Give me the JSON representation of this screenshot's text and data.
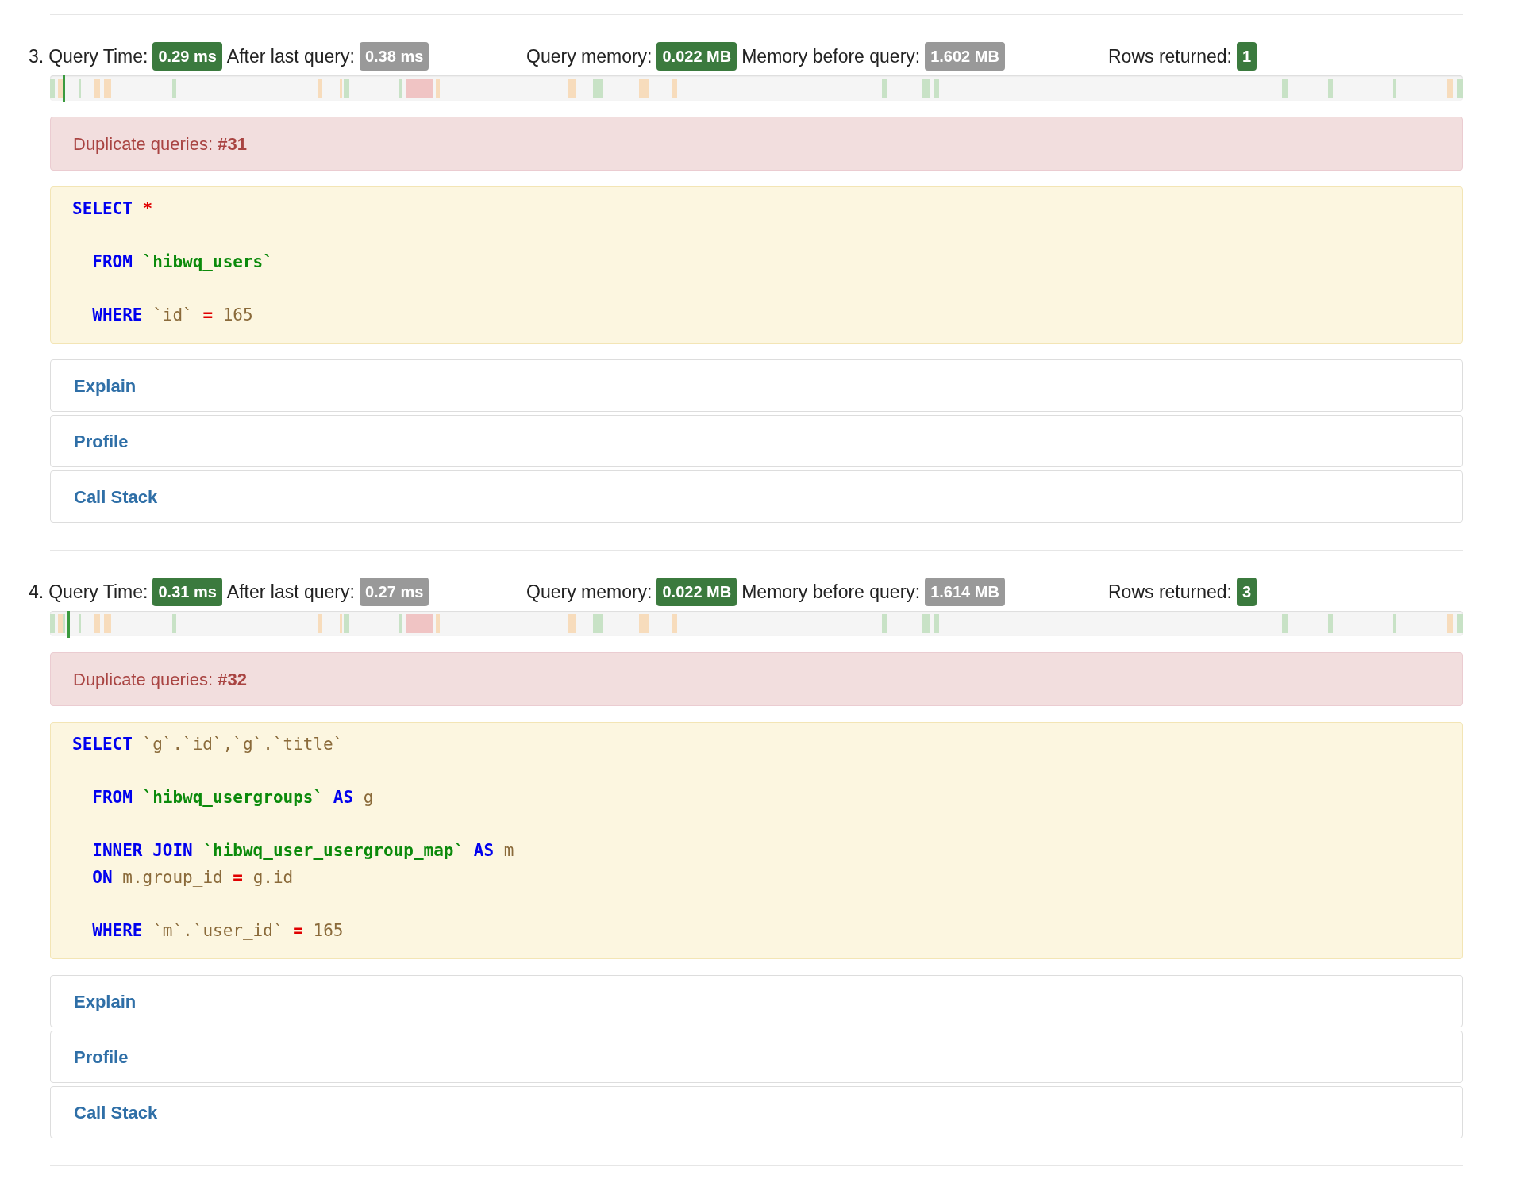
{
  "queries": [
    {
      "number": "3.",
      "query_time_label": "Query Time:",
      "query_time": "0.29 ms",
      "after_last_label": "After last query:",
      "after_last": "0.38 ms",
      "memory_label": "Query memory:",
      "memory": "0.022 MB",
      "memory_before_label": "Memory before query:",
      "memory_before": "1.602 MB",
      "rows_label": "Rows returned:",
      "rows": "1",
      "duplicate": "Duplicate queries: **#31**",
      "sql_clauses": [
        {
          "lines": [
            [
              {
                "kind": "keyword",
                "text": "SELECT"
              },
              {
                "kind": "operator",
                "text": "*"
              }
            ]
          ]
        },
        {
          "lines": [
            [
              {
                "kind": "keyword",
                "text": "  FROM"
              },
              {
                "kind": "table",
                "text": "`hibwq_users`"
              }
            ]
          ]
        },
        {
          "lines": [
            [
              {
                "kind": "keyword",
                "text": "  WHERE"
              },
              {
                "kind": "plain",
                "text": "`id`"
              },
              {
                "kind": "operator",
                "text": "="
              },
              {
                "kind": "plain",
                "text": "165"
              }
            ]
          ]
        }
      ],
      "actions": [
        "Explain",
        "Profile",
        "Call Stack"
      ]
    },
    {
      "number": "4.",
      "query_time_label": "Query Time:",
      "query_time": "0.31 ms",
      "after_last_label": "After last query:",
      "after_last": "0.27 ms",
      "memory_label": "Query memory:",
      "memory": "0.022 MB",
      "memory_before_label": "Memory before query:",
      "memory_before": "1.614 MB",
      "rows_label": "Rows returned:",
      "rows": "3",
      "duplicate": "Duplicate queries: **#32**",
      "sql_clauses": [
        {
          "lines": [
            [
              {
                "kind": "keyword",
                "text": "SELECT"
              },
              {
                "kind": "plain",
                "text": "`g`.`id`,`g`.`title`"
              }
            ]
          ]
        },
        {
          "lines": [
            [
              {
                "kind": "keyword",
                "text": "  FROM"
              },
              {
                "kind": "table",
                "text": "`hibwq_usergroups`"
              },
              {
                "kind": "keyword",
                "text": "AS"
              },
              {
                "kind": "plain",
                "text": "g"
              }
            ]
          ]
        },
        {
          "lines": [
            [
              {
                "kind": "keyword",
                "text": "  INNER JOIN"
              },
              {
                "kind": "table",
                "text": "`hibwq_user_usergroup_map`"
              },
              {
                "kind": "keyword",
                "text": "AS"
              },
              {
                "kind": "plain",
                "text": "m"
              }
            ],
            [
              {
                "kind": "keyword",
                "text": "  ON"
              },
              {
                "kind": "plain",
                "text": "m.group_id"
              },
              {
                "kind": "operator",
                "text": "="
              },
              {
                "kind": "plain",
                "text": "g.id"
              }
            ]
          ]
        },
        {
          "lines": [
            [
              {
                "kind": "keyword",
                "text": "  WHERE"
              },
              {
                "kind": "plain",
                "text": "`m`.`user_id`"
              },
              {
                "kind": "operator",
                "text": "="
              },
              {
                "kind": "plain",
                "text": "165"
              }
            ]
          ]
        }
      ],
      "actions": [
        "Explain",
        "Profile",
        "Call Stack"
      ]
    }
  ]
}
